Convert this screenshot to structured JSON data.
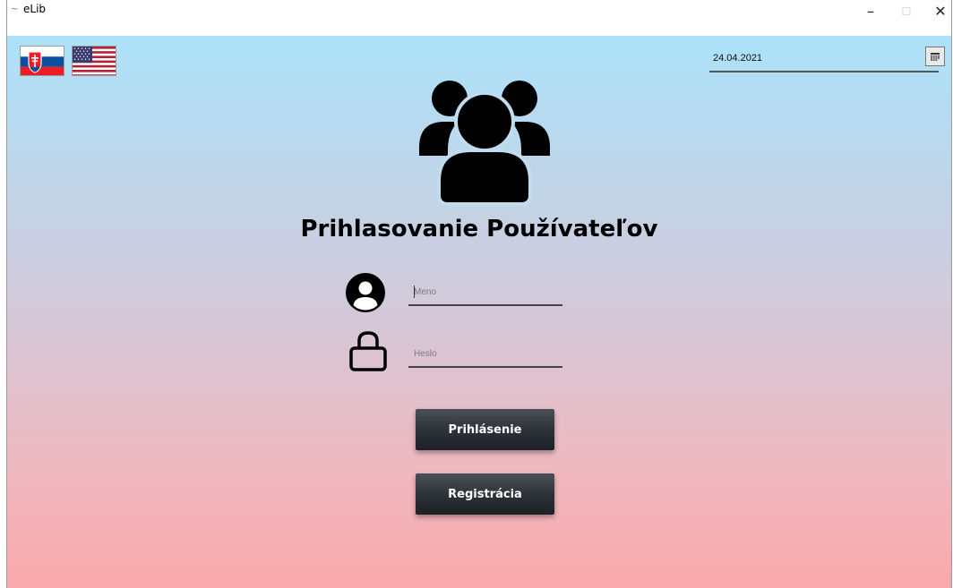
{
  "window": {
    "title": "eLib",
    "app_icon": "elib-app-icon",
    "controls": {
      "minimize": "–",
      "maximize": "☐",
      "close": "✕"
    }
  },
  "languages": [
    {
      "name": "slovak-flag-icon"
    },
    {
      "name": "us-flag-icon"
    }
  ],
  "date_picker": {
    "value": "24.04.2021",
    "icon": "calendar-icon"
  },
  "header_icon": "users-group-icon",
  "login": {
    "title": "Prihlasovanie Používateľov",
    "username": {
      "placeholder": "Meno",
      "value": "",
      "icon": "user-circle-icon"
    },
    "password": {
      "placeholder": "Heslo",
      "value": "",
      "icon": "lock-icon"
    },
    "login_button": "Prihlásenie",
    "register_button": "Registrácia"
  },
  "colors": {
    "gradient_top": "#abe2fa",
    "gradient_bottom": "#faa8ab",
    "button": "#2c3137"
  }
}
